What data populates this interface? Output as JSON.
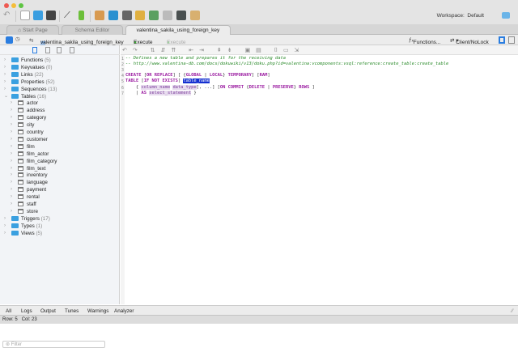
{
  "toolbar": {
    "workspace_label": "Workspace:",
    "workspace_value": "Default"
  },
  "tabs": [
    {
      "label": "Start Page"
    },
    {
      "label": "Schema Editor"
    },
    {
      "label": "valentina_sakila_using_foreign_key"
    }
  ],
  "querybar": {
    "database": "valentina_sakila_using_foreign_key",
    "execute": "Execute",
    "execute_current": "Execute Current",
    "functions": "Functions...",
    "mode": "Client/NoLock"
  },
  "tree": {
    "groups_top": [
      {
        "label": "Functions",
        "count": "(5)"
      },
      {
        "label": "Keyvalues",
        "count": "(0)"
      },
      {
        "label": "Links",
        "count": "(22)"
      },
      {
        "label": "Properties",
        "count": "(52)"
      },
      {
        "label": "Sequences",
        "count": "(13)"
      },
      {
        "label": "Tables",
        "count": "(16)"
      }
    ],
    "tables": [
      "actor",
      "address",
      "category",
      "city",
      "country",
      "customer",
      "film",
      "film_actor",
      "film_category",
      "film_text",
      "inventory",
      "language",
      "payment",
      "rental",
      "staff",
      "store"
    ],
    "groups_bottom": [
      {
        "label": "Triggers",
        "count": "(17)"
      },
      {
        "label": "Types",
        "count": "(1)"
      },
      {
        "label": "Views",
        "count": "(5)"
      }
    ],
    "filter_placeholder": "Filter"
  },
  "editor": {
    "lines": [
      [
        [
          "c",
          "-- Defines a new table and prepares it for the receiving data"
        ]
      ],
      [
        [
          "c",
          "-- http://www.valentina-db.com/docs/dokuwiki/v13/doku.php?id=valentina:vcomponents:vsql:reference:create_table:create_table"
        ]
      ],
      [],
      [
        [
          "k",
          "CREATE"
        ],
        [
          "p",
          " ["
        ],
        [
          "k",
          "OR REPLACE"
        ],
        [
          "p",
          "] [ {"
        ],
        [
          "k",
          "GLOBAL"
        ],
        [
          "p",
          " | "
        ],
        [
          "k",
          "LOCAL"
        ],
        [
          "p",
          "} "
        ],
        [
          "k",
          "TEMPORARY"
        ],
        [
          "p",
          "] ["
        ],
        [
          "k",
          "RAM"
        ],
        [
          "p",
          "]"
        ]
      ],
      [
        [
          "k",
          "TABLE"
        ],
        [
          "p",
          " ["
        ],
        [
          "k",
          "IF NOT EXISTS"
        ],
        [
          "p",
          "] "
        ],
        [
          "s",
          "table_name"
        ]
      ],
      [
        [
          "p",
          "    { "
        ],
        [
          "i",
          "column_name"
        ],
        [
          "p",
          " "
        ],
        [
          "i",
          "data_type"
        ],
        [
          "p",
          "[, ...] ["
        ],
        [
          "k",
          "ON COMMIT"
        ],
        [
          "p",
          " {"
        ],
        [
          "k",
          "DELETE"
        ],
        [
          "p",
          " | "
        ],
        [
          "k",
          "PRESERVE"
        ],
        [
          "p",
          "} "
        ],
        [
          "k",
          "ROWS"
        ],
        [
          "p",
          " ]"
        ]
      ],
      [
        [
          "p",
          "    | "
        ],
        [
          "k",
          "AS"
        ],
        [
          "p",
          " "
        ],
        [
          "i",
          "select_statement"
        ],
        [
          "p",
          " }"
        ]
      ]
    ]
  },
  "bottom_tabs": [
    "All",
    "Logs",
    "Output",
    "Tunes",
    "Warnings",
    "Analyzer"
  ],
  "status": {
    "row": "Row: 5",
    "col": "Col: 23"
  }
}
